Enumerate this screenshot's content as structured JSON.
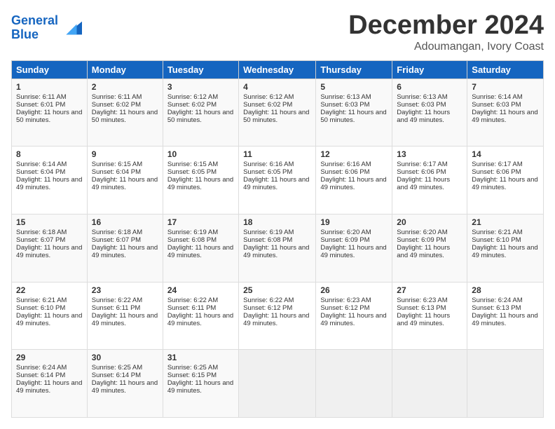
{
  "logo": {
    "line1": "General",
    "line2": "Blue"
  },
  "header": {
    "month": "December 2024",
    "location": "Adoumangan, Ivory Coast"
  },
  "weekdays": [
    "Sunday",
    "Monday",
    "Tuesday",
    "Wednesday",
    "Thursday",
    "Friday",
    "Saturday"
  ],
  "weeks": [
    [
      {
        "day": "1",
        "sunrise": "6:11 AM",
        "sunset": "6:01 PM",
        "daylight": "11 hours and 50 minutes."
      },
      {
        "day": "2",
        "sunrise": "6:11 AM",
        "sunset": "6:02 PM",
        "daylight": "11 hours and 50 minutes."
      },
      {
        "day": "3",
        "sunrise": "6:12 AM",
        "sunset": "6:02 PM",
        "daylight": "11 hours and 50 minutes."
      },
      {
        "day": "4",
        "sunrise": "6:12 AM",
        "sunset": "6:02 PM",
        "daylight": "11 hours and 50 minutes."
      },
      {
        "day": "5",
        "sunrise": "6:13 AM",
        "sunset": "6:03 PM",
        "daylight": "11 hours and 50 minutes."
      },
      {
        "day": "6",
        "sunrise": "6:13 AM",
        "sunset": "6:03 PM",
        "daylight": "11 hours and 49 minutes."
      },
      {
        "day": "7",
        "sunrise": "6:14 AM",
        "sunset": "6:03 PM",
        "daylight": "11 hours and 49 minutes."
      }
    ],
    [
      {
        "day": "8",
        "sunrise": "6:14 AM",
        "sunset": "6:04 PM",
        "daylight": "11 hours and 49 minutes."
      },
      {
        "day": "9",
        "sunrise": "6:15 AM",
        "sunset": "6:04 PM",
        "daylight": "11 hours and 49 minutes."
      },
      {
        "day": "10",
        "sunrise": "6:15 AM",
        "sunset": "6:05 PM",
        "daylight": "11 hours and 49 minutes."
      },
      {
        "day": "11",
        "sunrise": "6:16 AM",
        "sunset": "6:05 PM",
        "daylight": "11 hours and 49 minutes."
      },
      {
        "day": "12",
        "sunrise": "6:16 AM",
        "sunset": "6:06 PM",
        "daylight": "11 hours and 49 minutes."
      },
      {
        "day": "13",
        "sunrise": "6:17 AM",
        "sunset": "6:06 PM",
        "daylight": "11 hours and 49 minutes."
      },
      {
        "day": "14",
        "sunrise": "6:17 AM",
        "sunset": "6:06 PM",
        "daylight": "11 hours and 49 minutes."
      }
    ],
    [
      {
        "day": "15",
        "sunrise": "6:18 AM",
        "sunset": "6:07 PM",
        "daylight": "11 hours and 49 minutes."
      },
      {
        "day": "16",
        "sunrise": "6:18 AM",
        "sunset": "6:07 PM",
        "daylight": "11 hours and 49 minutes."
      },
      {
        "day": "17",
        "sunrise": "6:19 AM",
        "sunset": "6:08 PM",
        "daylight": "11 hours and 49 minutes."
      },
      {
        "day": "18",
        "sunrise": "6:19 AM",
        "sunset": "6:08 PM",
        "daylight": "11 hours and 49 minutes."
      },
      {
        "day": "19",
        "sunrise": "6:20 AM",
        "sunset": "6:09 PM",
        "daylight": "11 hours and 49 minutes."
      },
      {
        "day": "20",
        "sunrise": "6:20 AM",
        "sunset": "6:09 PM",
        "daylight": "11 hours and 49 minutes."
      },
      {
        "day": "21",
        "sunrise": "6:21 AM",
        "sunset": "6:10 PM",
        "daylight": "11 hours and 49 minutes."
      }
    ],
    [
      {
        "day": "22",
        "sunrise": "6:21 AM",
        "sunset": "6:10 PM",
        "daylight": "11 hours and 49 minutes."
      },
      {
        "day": "23",
        "sunrise": "6:22 AM",
        "sunset": "6:11 PM",
        "daylight": "11 hours and 49 minutes."
      },
      {
        "day": "24",
        "sunrise": "6:22 AM",
        "sunset": "6:11 PM",
        "daylight": "11 hours and 49 minutes."
      },
      {
        "day": "25",
        "sunrise": "6:22 AM",
        "sunset": "6:12 PM",
        "daylight": "11 hours and 49 minutes."
      },
      {
        "day": "26",
        "sunrise": "6:23 AM",
        "sunset": "6:12 PM",
        "daylight": "11 hours and 49 minutes."
      },
      {
        "day": "27",
        "sunrise": "6:23 AM",
        "sunset": "6:13 PM",
        "daylight": "11 hours and 49 minutes."
      },
      {
        "day": "28",
        "sunrise": "6:24 AM",
        "sunset": "6:13 PM",
        "daylight": "11 hours and 49 minutes."
      }
    ],
    [
      {
        "day": "29",
        "sunrise": "6:24 AM",
        "sunset": "6:14 PM",
        "daylight": "11 hours and 49 minutes."
      },
      {
        "day": "30",
        "sunrise": "6:25 AM",
        "sunset": "6:14 PM",
        "daylight": "11 hours and 49 minutes."
      },
      {
        "day": "31",
        "sunrise": "6:25 AM",
        "sunset": "6:15 PM",
        "daylight": "11 hours and 49 minutes."
      },
      null,
      null,
      null,
      null
    ]
  ]
}
